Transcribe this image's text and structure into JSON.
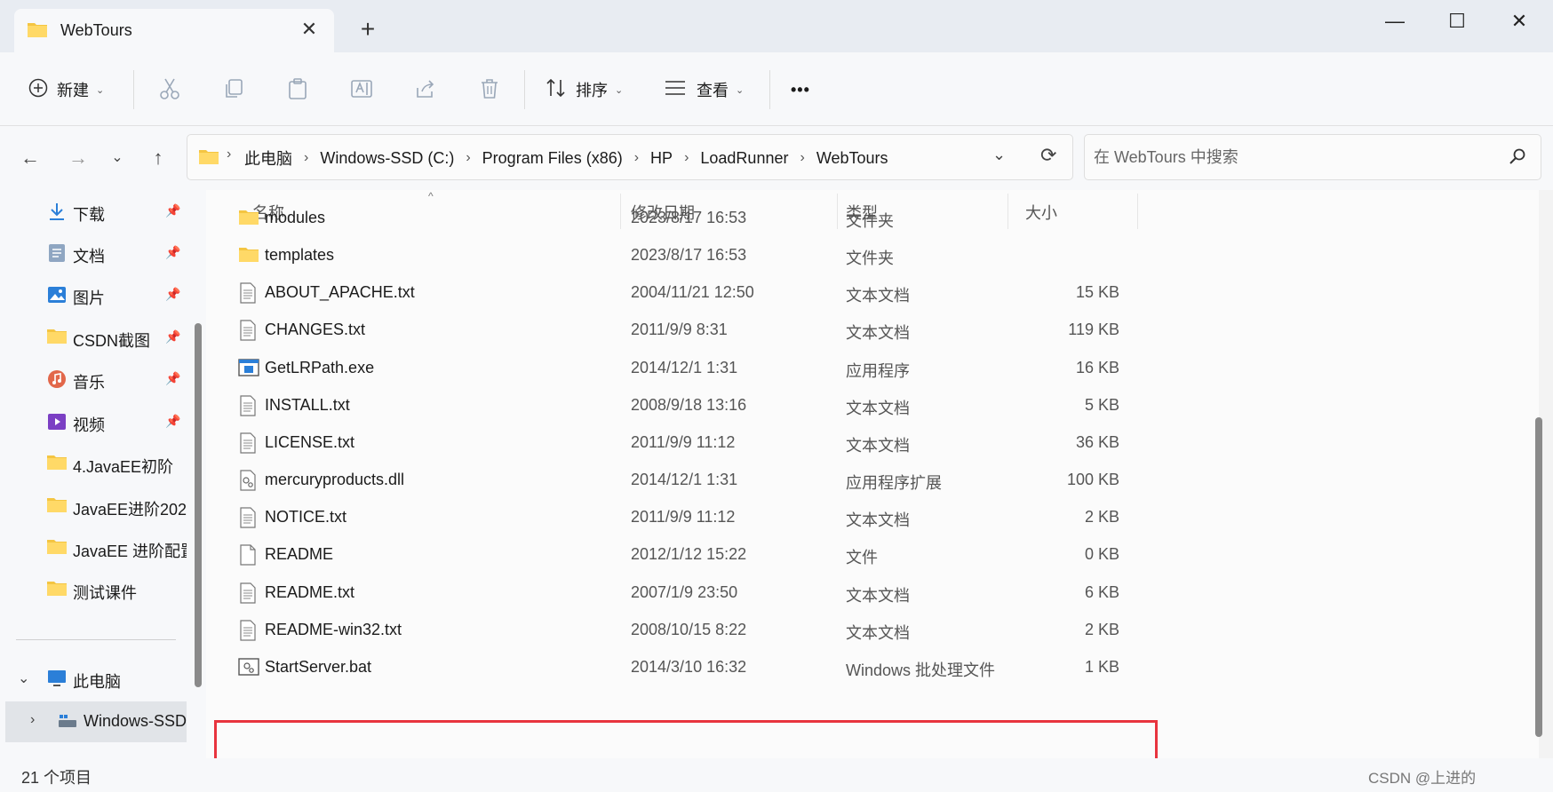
{
  "window": {
    "tab_title": "WebTours",
    "new_tab": "+",
    "minimize": "—",
    "maximize": "☐",
    "close": "✕"
  },
  "toolbar": {
    "new_label": "新建",
    "sort_label": "排序",
    "view_label": "查看",
    "more": "•••"
  },
  "address": {
    "crumbs": [
      "此电脑",
      "Windows-SSD (C:)",
      "Program Files (x86)",
      "HP",
      "LoadRunner",
      "WebTours"
    ],
    "search_placeholder": "在 WebTours 中搜索"
  },
  "sidebar": {
    "items": [
      {
        "label": "下载",
        "icon": "download-icon",
        "pinned": true
      },
      {
        "label": "文档",
        "icon": "documents-icon",
        "pinned": true
      },
      {
        "label": "图片",
        "icon": "pictures-icon",
        "pinned": true
      },
      {
        "label": "CSDN截图",
        "icon": "folder-icon",
        "pinned": true
      },
      {
        "label": "音乐",
        "icon": "music-icon",
        "pinned": true
      },
      {
        "label": "视频",
        "icon": "videos-icon",
        "pinned": true
      },
      {
        "label": "4.JavaEE初阶",
        "icon": "folder-icon",
        "pinned": false
      },
      {
        "label": "JavaEE进阶202",
        "icon": "folder-icon",
        "pinned": false
      },
      {
        "label": "JavaEE 进阶配置",
        "icon": "folder-icon",
        "pinned": false
      },
      {
        "label": "测试课件",
        "icon": "folder-icon",
        "pinned": false
      }
    ],
    "this_pc": "此电脑",
    "drive": "Windows-SSD"
  },
  "columns": {
    "name": "名称",
    "date": "修改日期",
    "type": "类型",
    "size": "大小"
  },
  "files": [
    {
      "name": "modules",
      "date": "2023/8/17 16:53",
      "type": "文件夹",
      "size": "",
      "icon": "folder-icon"
    },
    {
      "name": "templates",
      "date": "2023/8/17 16:53",
      "type": "文件夹",
      "size": "",
      "icon": "folder-icon"
    },
    {
      "name": "ABOUT_APACHE.txt",
      "date": "2004/11/21 12:50",
      "type": "文本文档",
      "size": "15 KB",
      "icon": "text-file-icon"
    },
    {
      "name": "CHANGES.txt",
      "date": "2011/9/9 8:31",
      "type": "文本文档",
      "size": "119 KB",
      "icon": "text-file-icon"
    },
    {
      "name": "GetLRPath.exe",
      "date": "2014/12/1 1:31",
      "type": "应用程序",
      "size": "16 KB",
      "icon": "exe-file-icon"
    },
    {
      "name": "INSTALL.txt",
      "date": "2008/9/18 13:16",
      "type": "文本文档",
      "size": "5 KB",
      "icon": "text-file-icon"
    },
    {
      "name": "LICENSE.txt",
      "date": "2011/9/9 11:12",
      "type": "文本文档",
      "size": "36 KB",
      "icon": "text-file-icon"
    },
    {
      "name": "mercuryproducts.dll",
      "date": "2014/12/1 1:31",
      "type": "应用程序扩展",
      "size": "100 KB",
      "icon": "dll-file-icon"
    },
    {
      "name": "NOTICE.txt",
      "date": "2011/9/9 11:12",
      "type": "文本文档",
      "size": "2 KB",
      "icon": "text-file-icon"
    },
    {
      "name": "README",
      "date": "2012/1/12 15:22",
      "type": "文件",
      "size": "0 KB",
      "icon": "blank-file-icon"
    },
    {
      "name": "README.txt",
      "date": "2007/1/9 23:50",
      "type": "文本文档",
      "size": "6 KB",
      "icon": "text-file-icon"
    },
    {
      "name": "README-win32.txt",
      "date": "2008/10/15 8:22",
      "type": "文本文档",
      "size": "2 KB",
      "icon": "text-file-icon"
    },
    {
      "name": "StartServer.bat",
      "date": "2014/3/10 16:32",
      "type": "Windows 批处理文件",
      "size": "1 KB",
      "icon": "bat-file-icon"
    }
  ],
  "status": {
    "count": "21 个项目",
    "watermark": "CSDN @上进的"
  },
  "colors": {
    "highlight": "#e8343e",
    "folder": "#f4c542"
  }
}
